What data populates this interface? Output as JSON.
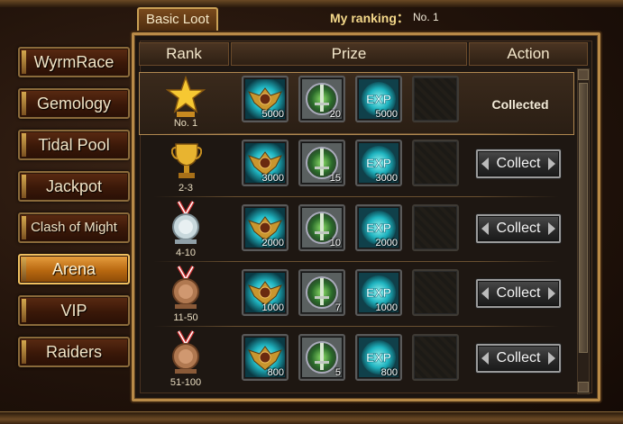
{
  "tab": {
    "label": "Basic Loot"
  },
  "ranking": {
    "label": "My ranking：",
    "value": "No. 1"
  },
  "sidebar": {
    "items": [
      {
        "label": "WyrmRace"
      },
      {
        "label": "Gemology"
      },
      {
        "label": "Tidal Pool"
      },
      {
        "label": "Jackpot"
      },
      {
        "label": "Clash of Might"
      },
      {
        "label": "Arena",
        "active": true
      },
      {
        "label": "VIP"
      },
      {
        "label": "Raiders"
      }
    ]
  },
  "table": {
    "headers": {
      "rank": "Rank",
      "prize": "Prize",
      "action": "Action"
    },
    "rows": [
      {
        "rank": "No. 1",
        "rank_icon": "star-trophy",
        "prizes": [
          "5000",
          "20",
          "5000"
        ],
        "action": "Collected",
        "collected": true
      },
      {
        "rank": "2-3",
        "rank_icon": "gold-cup",
        "prizes": [
          "3000",
          "15",
          "3000"
        ],
        "action": "Collect",
        "collected": false
      },
      {
        "rank": "4-10",
        "rank_icon": "silver-medal",
        "prizes": [
          "2000",
          "10",
          "2000"
        ],
        "action": "Collect",
        "collected": false
      },
      {
        "rank": "11-50",
        "rank_icon": "bronze-medal",
        "prizes": [
          "1000",
          "7",
          "1000"
        ],
        "action": "Collect",
        "collected": false
      },
      {
        "rank": "51-100",
        "rank_icon": "bronze-medal",
        "prizes": [
          "800",
          "5",
          "800"
        ],
        "action": "Collect",
        "collected": false
      }
    ],
    "prize_icons": [
      "winged-crest-icon",
      "sword-shield-icon",
      "exp-orb-icon",
      "empty-slot"
    ],
    "exp_icon_text": "EXP"
  },
  "colors": {
    "accent_gold": "#c9a055",
    "active_orange": "#e8a040",
    "teal": "#2fd0d0"
  }
}
